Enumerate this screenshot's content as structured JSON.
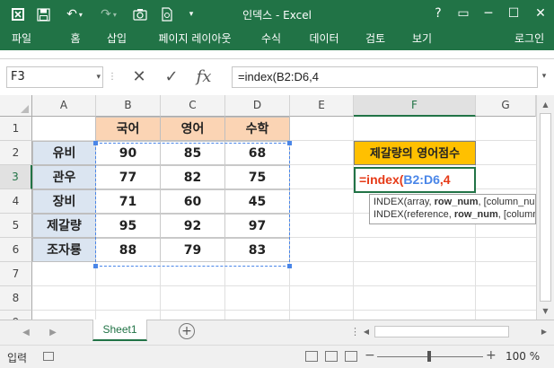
{
  "titlebar": {
    "title": "인덱스 - Excel",
    "help": "?",
    "restore": "▭",
    "minimize": "─",
    "maximize": "☐",
    "close": "✕"
  },
  "ribbon": {
    "tabs": [
      "파일",
      "홈",
      "삽입",
      "페이지 레이아웃",
      "수식",
      "데이터",
      "검토",
      "보기"
    ],
    "login": "로그인"
  },
  "formula_bar": {
    "name_box": "F3",
    "formula": "=index(B2:D6,4"
  },
  "grid": {
    "columns": [
      "A",
      "B",
      "C",
      "D",
      "E",
      "F",
      "G"
    ],
    "selected_column": "F",
    "rows": [
      "1",
      "2",
      "3",
      "4",
      "5",
      "6",
      "7",
      "8",
      "9"
    ],
    "selected_row": "3",
    "subject_headers": [
      "국어",
      "영어",
      "수학"
    ],
    "students": [
      {
        "name": "유비",
        "scores": [
          "90",
          "85",
          "68"
        ]
      },
      {
        "name": "관우",
        "scores": [
          "77",
          "82",
          "75"
        ]
      },
      {
        "name": "장비",
        "scores": [
          "71",
          "60",
          "45"
        ]
      },
      {
        "name": "제갈량",
        "scores": [
          "95",
          "92",
          "97"
        ]
      },
      {
        "name": "조자룡",
        "scores": [
          "88",
          "79",
          "83"
        ]
      }
    ],
    "label_cell": "제갈량의 영어점수",
    "active_cell": {
      "prefix": "=index(",
      "range": "B2:D6",
      "suffix": ",4"
    },
    "tooltip": {
      "line1_prefix": "INDEX(array, ",
      "line1_bold": "row_num",
      "line1_suffix": ", [column_num",
      "line2_prefix": "INDEX(reference, ",
      "line2_bold": "row_num",
      "line2_suffix": ", [column_"
    }
  },
  "sheet_tabs": {
    "active": "Sheet1",
    "add": "+"
  },
  "status_bar": {
    "mode": "입력",
    "zoom_minus": "−",
    "zoom_plus": "+",
    "zoom": "100 %"
  },
  "colors": {
    "excel_green": "#217346",
    "header_fill": "#fbd4b4",
    "name_fill": "#dbe5f1",
    "label_fill": "#ffc000",
    "function_red": "#e63a17",
    "range_blue": "#4a86e8"
  }
}
